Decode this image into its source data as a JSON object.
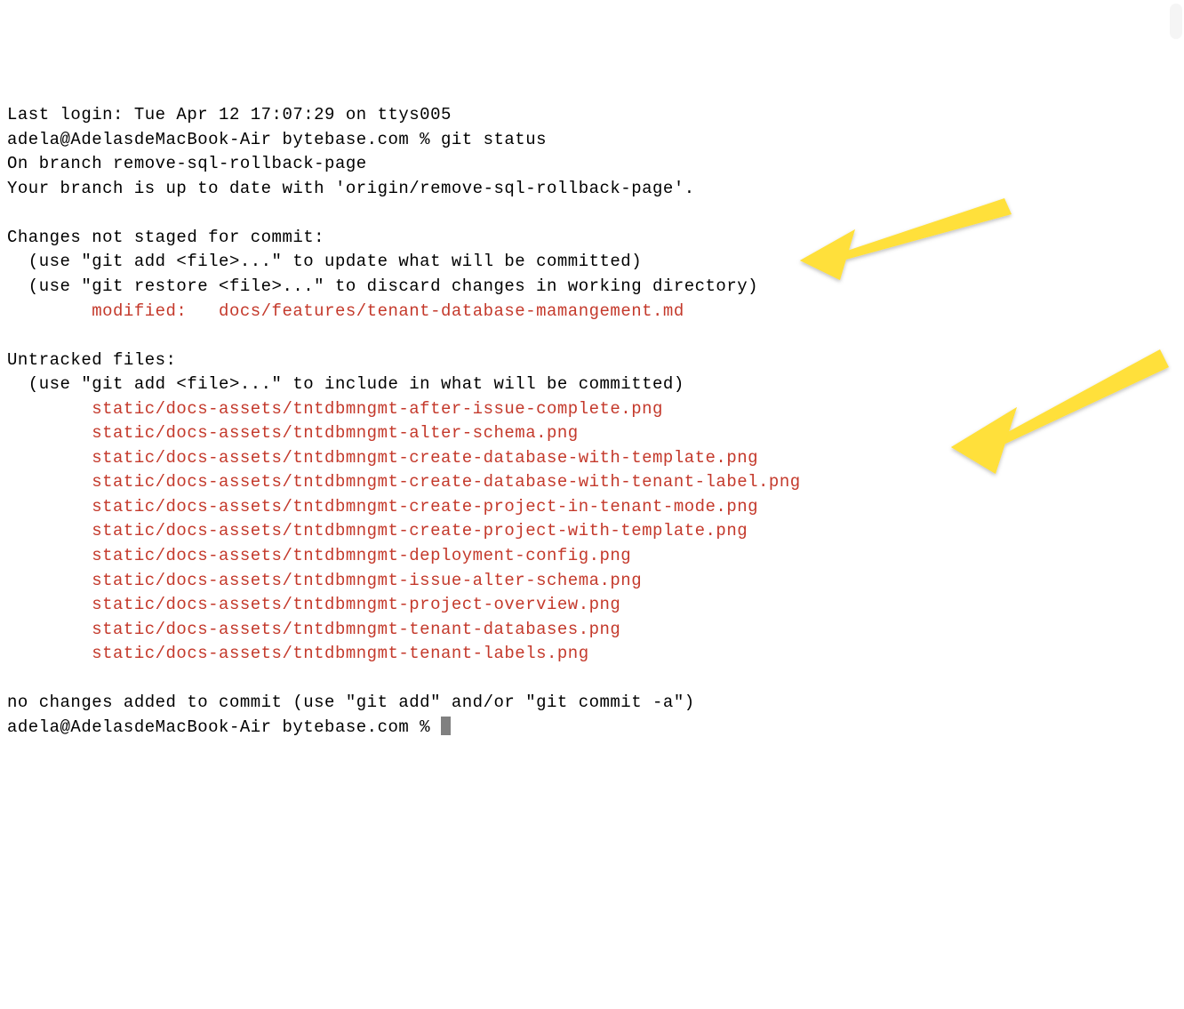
{
  "terminal": {
    "last_login": "Last login: Tue Apr 12 17:07:29 on ttys005",
    "prompt_line1_user": "adela@AdelasdeMacBook-Air bytebase.com % ",
    "command1": "git status",
    "branch_line": "On branch remove-sql-rollback-page",
    "uptodate_line": "Your branch is up to date with 'origin/remove-sql-rollback-page'.",
    "changes_header": "Changes not staged for commit:",
    "hint_add": "  (use \"git add <file>...\" to update what will be committed)",
    "hint_restore": "  (use \"git restore <file>...\" to discard changes in working directory)",
    "modified_label": "        modified:   ",
    "modified_file": "docs/features/tenant-database-mamangement.md",
    "untracked_header": "Untracked files:",
    "hint_include": "  (use \"git add <file>...\" to include in what will be committed)",
    "untracked": [
      "        static/docs-assets/tntdbmngmt-after-issue-complete.png",
      "        static/docs-assets/tntdbmngmt-alter-schema.png",
      "        static/docs-assets/tntdbmngmt-create-database-with-template.png",
      "        static/docs-assets/tntdbmngmt-create-database-with-tenant-label.png",
      "        static/docs-assets/tntdbmngmt-create-project-in-tenant-mode.png",
      "        static/docs-assets/tntdbmngmt-create-project-with-template.png",
      "        static/docs-assets/tntdbmngmt-deployment-config.png",
      "        static/docs-assets/tntdbmngmt-issue-alter-schema.png",
      "        static/docs-assets/tntdbmngmt-project-overview.png",
      "        static/docs-assets/tntdbmngmt-tenant-databases.png",
      "        static/docs-assets/tntdbmngmt-tenant-labels.png"
    ],
    "no_changes_line": "no changes added to commit (use \"git add\" and/or \"git commit -a\")",
    "prompt_line2_user": "adela@AdelasdeMacBook-Air bytebase.com % "
  },
  "annotation": {
    "arrow_color": "#ffe03a"
  }
}
